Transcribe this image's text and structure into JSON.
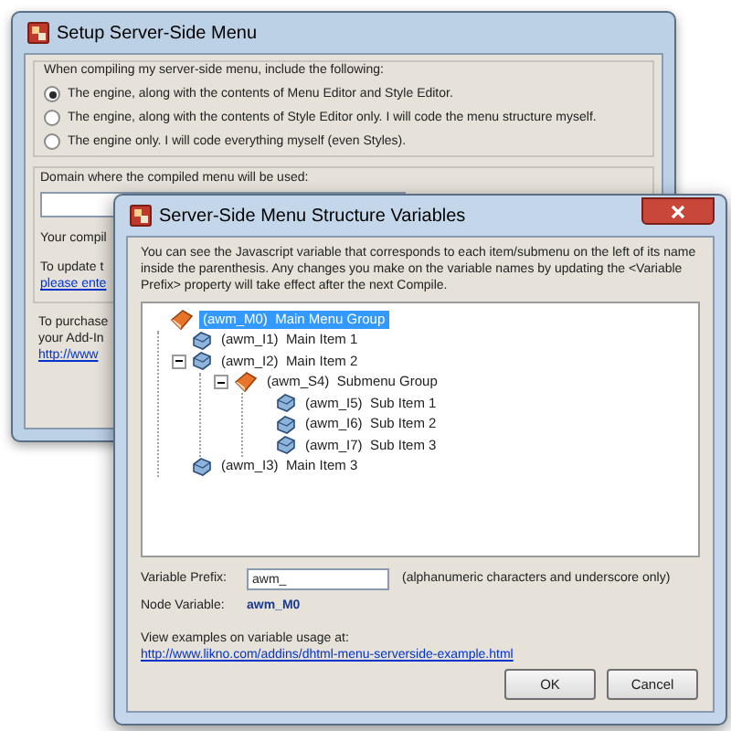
{
  "back_window": {
    "title": "Setup Server-Side Menu",
    "group_label": "When compiling my server-side menu, include the following:",
    "options": [
      {
        "label": "The engine, along with the contents of Menu Editor and Style Editor.",
        "selected": true
      },
      {
        "label": "The engine, along with the contents of Style Editor only. I will code the menu structure myself.",
        "selected": false
      },
      {
        "label": "The engine only. I will code everything myself (even Styles).",
        "selected": false
      }
    ],
    "domain_label": "Domain where the compiled menu will be used:",
    "compile_text": "Your compil",
    "update_text": "To update t",
    "update_link": "please ente",
    "purchase_text": "To purchase",
    "addin_text": "your Add-In",
    "purchase_link": "http://www"
  },
  "dialog": {
    "title": "Server-Side Menu Structure Variables",
    "description": "You can see the Javascript variable that corresponds to each item/submenu on the left of its name inside the parenthesis. Any changes you make on the variable names by updating the <Variable Prefix> property will take effect after the next Compile.",
    "tree": [
      {
        "kind": "group",
        "variable": "(awm_M0)",
        "label": "Main Menu Group",
        "selected": true,
        "children": [
          {
            "kind": "item",
            "variable": "(awm_I1)",
            "label": "Main Item 1",
            "selected": false
          },
          {
            "kind": "item",
            "variable": "(awm_I2)",
            "label": "Main Item 2",
            "selected": false,
            "expanded": true,
            "children": [
              {
                "kind": "group",
                "variable": "(awm_S4)",
                "label": "Submenu Group",
                "selected": false,
                "expanded": true,
                "children": [
                  {
                    "kind": "item",
                    "variable": "(awm_I5)",
                    "label": "Sub Item 1",
                    "selected": false
                  },
                  {
                    "kind": "item",
                    "variable": "(awm_I6)",
                    "label": "Sub Item 2",
                    "selected": false
                  },
                  {
                    "kind": "item",
                    "variable": "(awm_I7)",
                    "label": "Sub Item 3",
                    "selected": false
                  }
                ]
              }
            ]
          },
          {
            "kind": "item",
            "variable": "(awm_I3)",
            "label": "Main Item 3",
            "selected": false
          }
        ]
      }
    ],
    "prefix_label": "Variable Prefix:",
    "prefix_value": "awm_",
    "prefix_hint": "(alphanumeric characters and underscore only)",
    "node_label": "Node Variable:",
    "node_value": "awm_M0",
    "examples_text": "View examples on variable usage at:",
    "examples_link": "http://www.likno.com/addins/dhtml-menu-serverside-example.html",
    "buttons": [
      "OK",
      "Cancel"
    ]
  }
}
